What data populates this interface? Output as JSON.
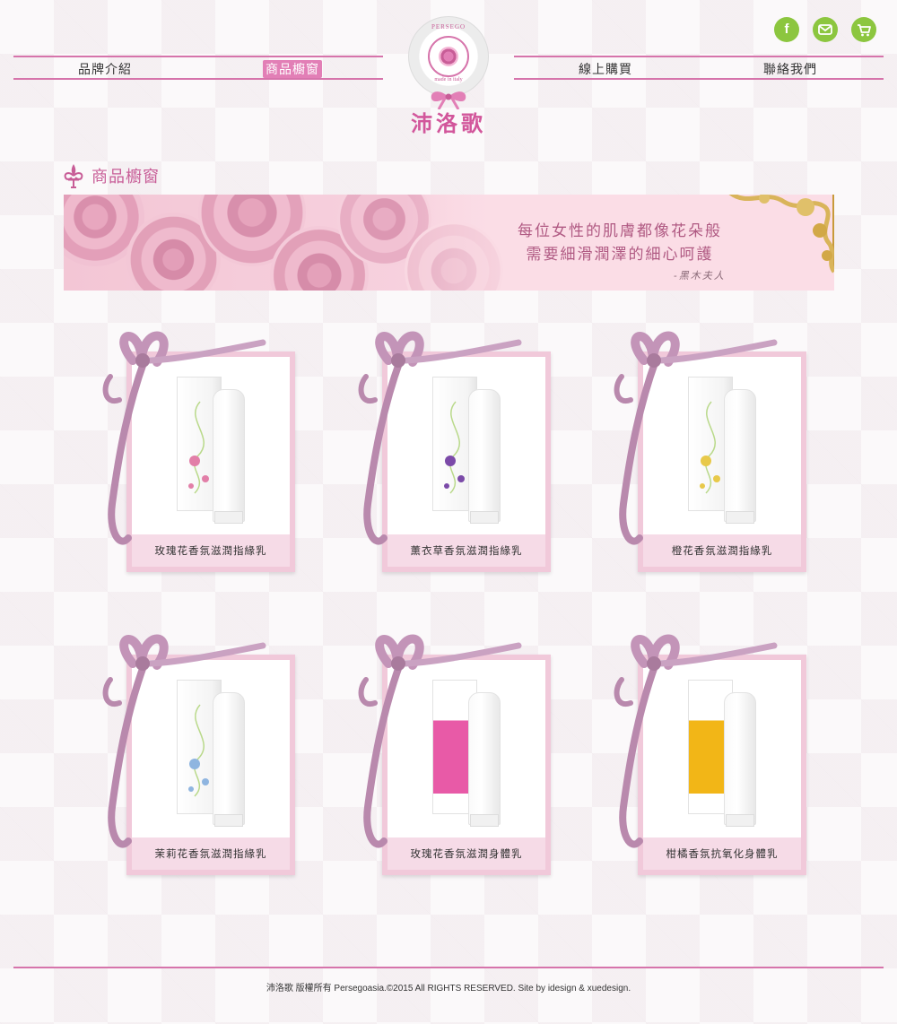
{
  "header": {
    "nav": [
      "品牌介紹",
      "商品櫥窗",
      "線上購買",
      "聯絡我們"
    ],
    "logo": {
      "small_text": "PERSEGO",
      "made_text": "made in italy",
      "name": "沛洛歌"
    },
    "social": [
      {
        "icon": "facebook-icon",
        "glyph": "f"
      },
      {
        "icon": "mail-icon",
        "glyph": "✉"
      },
      {
        "icon": "cart-icon",
        "glyph": "🛒"
      }
    ],
    "colors": {
      "accent": "#d674ab",
      "social": "#8cc63f"
    }
  },
  "section": {
    "title": "商品櫥窗"
  },
  "banner": {
    "line1": "每位女性的肌膚都像花朵般",
    "line2": "需要細滑潤澤的細心呵護",
    "signature": "-黑木夫人"
  },
  "products": [
    {
      "name": "玫瑰花香氛滋潤指緣乳",
      "accent": "#e27fa8"
    },
    {
      "name": "薰衣草香氛滋潤指緣乳",
      "accent": "#7b4aa8"
    },
    {
      "name": "橙花香氛滋潤指緣乳",
      "accent": "#e8c94a"
    },
    {
      "name": "茉莉花香氛滋潤指緣乳",
      "accent": "#8fb5e0"
    },
    {
      "name": "玫瑰花香氛滋潤身體乳",
      "accent": "#e85aa7"
    },
    {
      "name": "柑橘香氛抗氧化身體乳",
      "accent": "#f2b617"
    }
  ],
  "footer": {
    "text": "沛洛歌 版權所有 Persegoasia.©2015 All RIGHTS RESERVED. Site by idesign & xuedesign."
  }
}
